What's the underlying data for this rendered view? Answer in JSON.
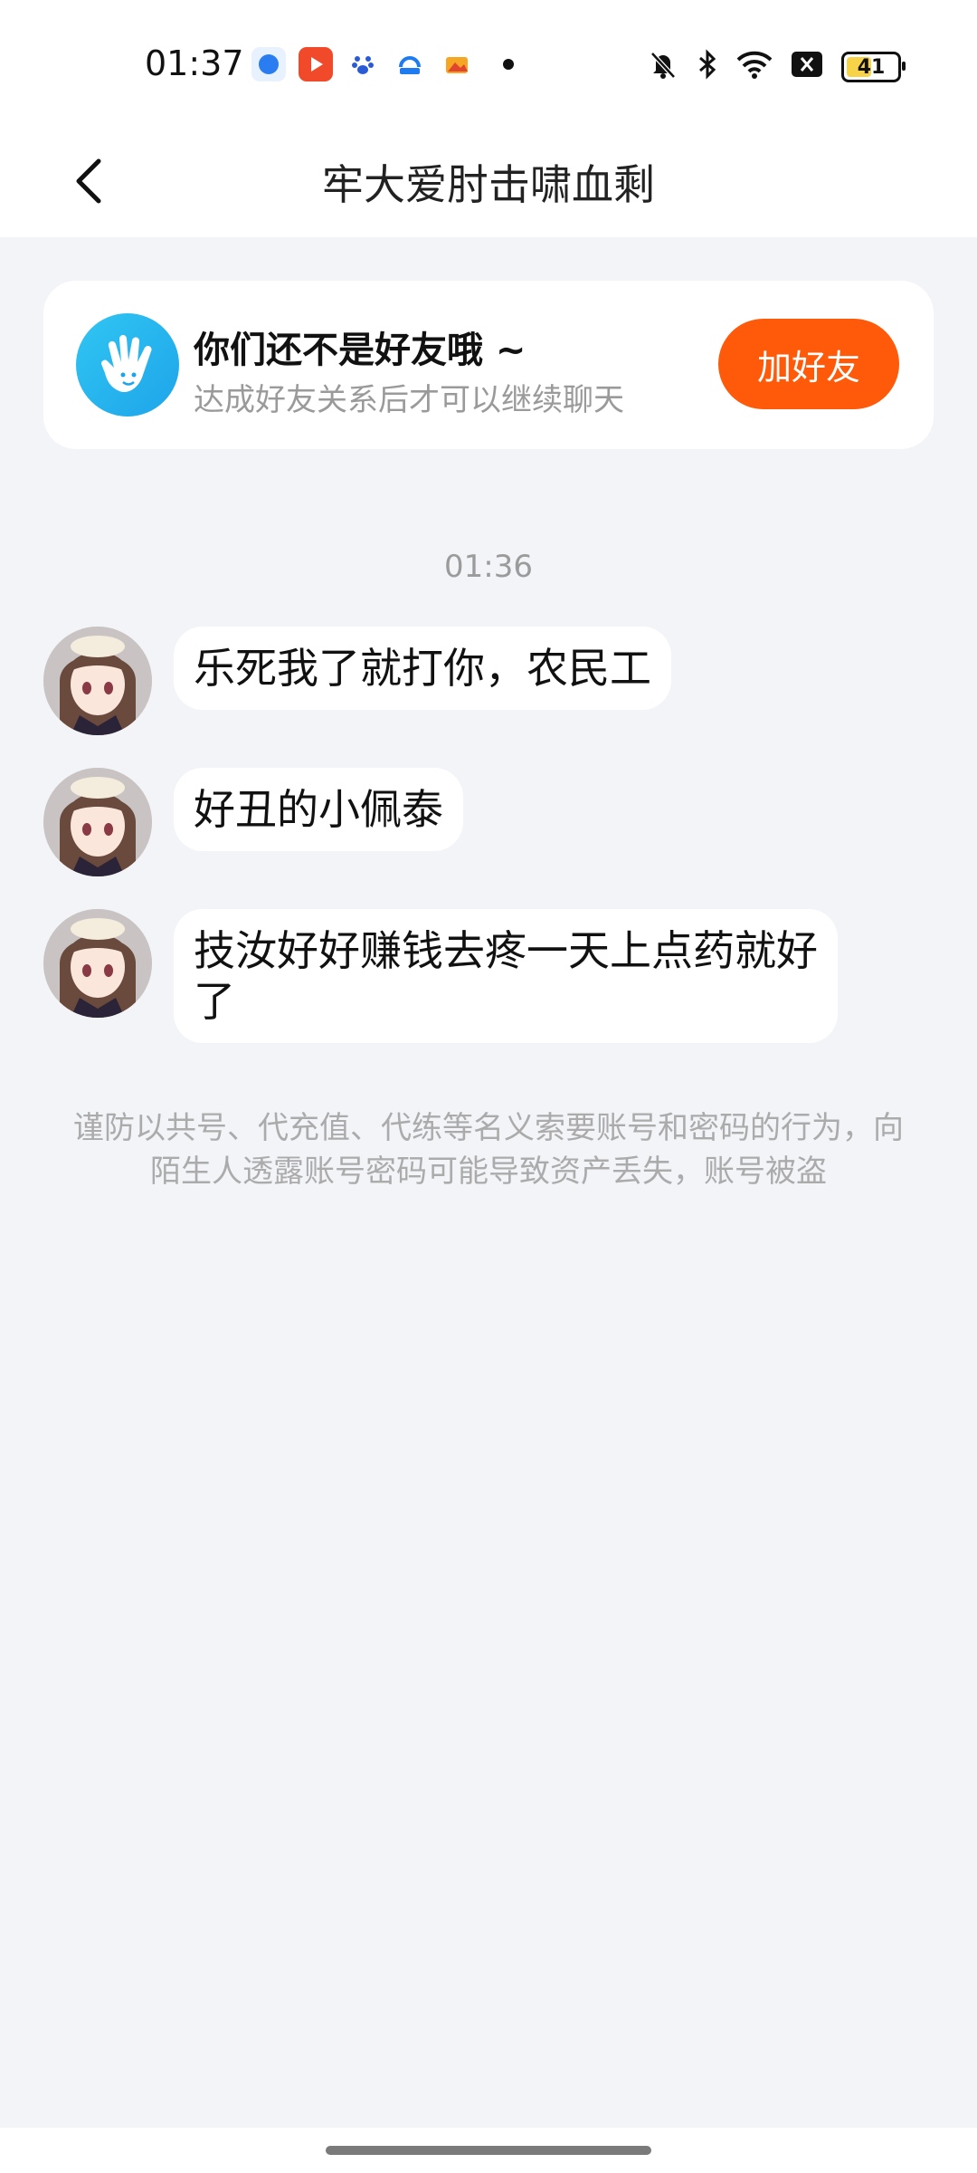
{
  "status_bar": {
    "time": "01:37",
    "battery_level": "41",
    "app_icons": [
      "notification-app-icon",
      "video-app-icon",
      "baidu-icon",
      "security-app-icon",
      "photo-app-icon"
    ],
    "right_icons": [
      "bell-muted-icon",
      "bluetooth-icon",
      "wifi-icon",
      "close-box-icon",
      "battery-icon"
    ]
  },
  "header": {
    "title": "牢大爱肘击啸血剩",
    "back_icon": "chevron-left-icon"
  },
  "friend_card": {
    "icon": "waving-hand-icon",
    "title": "你们还不是好友哦 ~",
    "subtitle": "达成好友关系后才可以继续聊天",
    "button_label": "加好友"
  },
  "chat": {
    "timestamp": "01:36",
    "messages": [
      {
        "text": "乐死我了就打你，农民工"
      },
      {
        "text": "好丑的小佩泰"
      },
      {
        "text": "技汝好好赚钱去疼一天上点药就好了"
      }
    ]
  },
  "warning": "谨防以共号、代充值、代练等名义索要账号和密码的行为，向陌生人透露账号密码可能导致资产丢失，账号被盗",
  "colors": {
    "accent": "#ff5a0a",
    "background": "#f2f4f8",
    "card_icon": "#1ea4ea"
  }
}
